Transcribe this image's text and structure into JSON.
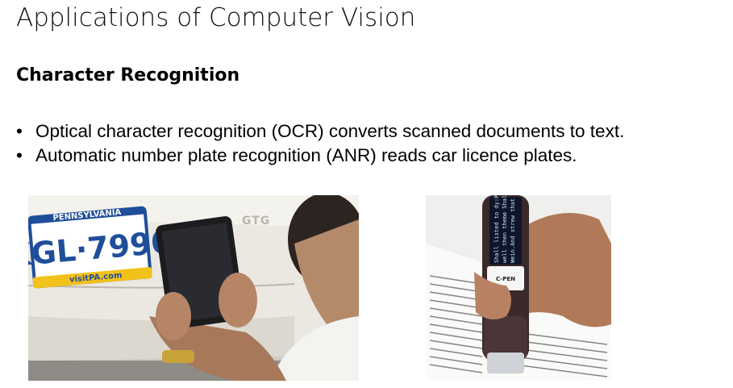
{
  "title": "Applications of Computer Vision",
  "heading": "Character Recognition",
  "bullets": [
    "Optical character recognition (OCR) converts scanned documents to text.",
    "Automatic number plate recognition (ANR) reads car licence plates."
  ],
  "photo_plate": {
    "state": "PENNSYLVANIA",
    "number": "KGL·7990",
    "website": "visitPA.com",
    "badge": "GTG",
    "colors": {
      "plate_blue": "#1f4e9a",
      "plate_yellow": "#f2c21a",
      "car_body": "#ece9e2"
    }
  },
  "photo_pen": {
    "brand": "C-PEN",
    "screen_lines": [
      "Shall listed to dy:Pz",
      "well then theme Shall",
      "Wein.And strew that"
    ],
    "colors": {
      "pen_body": "#3a2a2a",
      "screen": "#10162a"
    }
  }
}
